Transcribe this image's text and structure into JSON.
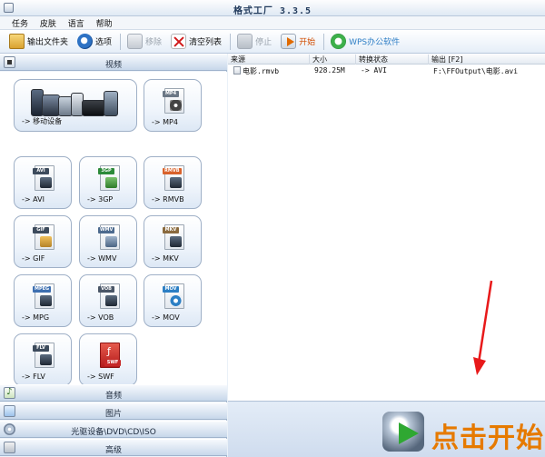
{
  "window": {
    "title": "格式工厂 3.3.5"
  },
  "menu": {
    "items": [
      "任务",
      "皮肤",
      "语言",
      "帮助"
    ]
  },
  "toolbar": {
    "output_folder": "输出文件夹",
    "options": "选项",
    "remove": "移除",
    "clear_list": "清空列表",
    "stop": "停止",
    "start": "开始",
    "wps": "WPS办公软件"
  },
  "sidebar": {
    "video": "视频",
    "audio": "音频",
    "picture": "图片",
    "rom": "光驱设备\\DVD\\CD\\ISO",
    "advanced": "高级"
  },
  "tiles": [
    {
      "label": "-> 移动设备",
      "icon": "mobile-devices-icon"
    },
    {
      "label": "-> MP4",
      "icon": "mp4-file-icon",
      "tag": "MP4",
      "color": "#6b7785"
    },
    {
      "label": "-> AVI",
      "icon": "avi-file-icon",
      "tag": "AVI",
      "color": "#3d4b5c"
    },
    {
      "label": "-> 3GP",
      "icon": "3gp-file-icon",
      "tag": "3GP",
      "color": "#2c8a3a"
    },
    {
      "label": "-> RMVB",
      "icon": "rmvb-file-icon",
      "tag": "RMVB",
      "color": "#d9622b"
    },
    {
      "label": "-> GIF",
      "icon": "gif-file-icon",
      "tag": "GIF",
      "color": "#3d4b5c"
    },
    {
      "label": "-> WMV",
      "icon": "wmv-file-icon",
      "tag": "WMV",
      "color": "#4c6a8e"
    },
    {
      "label": "-> MKV",
      "icon": "mkv-file-icon",
      "tag": "MKV",
      "color": "#8a6a3e"
    },
    {
      "label": "-> MPG",
      "icon": "mpg-file-icon",
      "tag": "MPEG",
      "color": "#3d6fb0"
    },
    {
      "label": "-> VOB",
      "icon": "vob-file-icon",
      "tag": "VOB",
      "color": "#4a5667"
    },
    {
      "label": "-> MOV",
      "icon": "mov-file-icon",
      "tag": "MOV",
      "color": "#2c7fc4"
    },
    {
      "label": "-> FLV",
      "icon": "flv-file-icon",
      "tag": "FLV",
      "color": "#3d4b5c"
    },
    {
      "label": "-> SWF",
      "icon": "swf-file-icon",
      "tag": "SWF",
      "color": "#c62828"
    }
  ],
  "filelist": {
    "columns": [
      "来源",
      "大小",
      "转换状态",
      "输出 [F2]"
    ],
    "rows": [
      {
        "source": "电影.rmvb",
        "size": "928.25M",
        "status": "-> AVI",
        "output": "F:\\FFOutput\\电影.avi"
      }
    ]
  },
  "start_banner": {
    "label": "点击开始"
  },
  "colors": {
    "accent": "#e67a00",
    "start_text": "#d14b00",
    "wps_text": "#2f7fc6",
    "annotation_arrow": "#e8191a"
  }
}
